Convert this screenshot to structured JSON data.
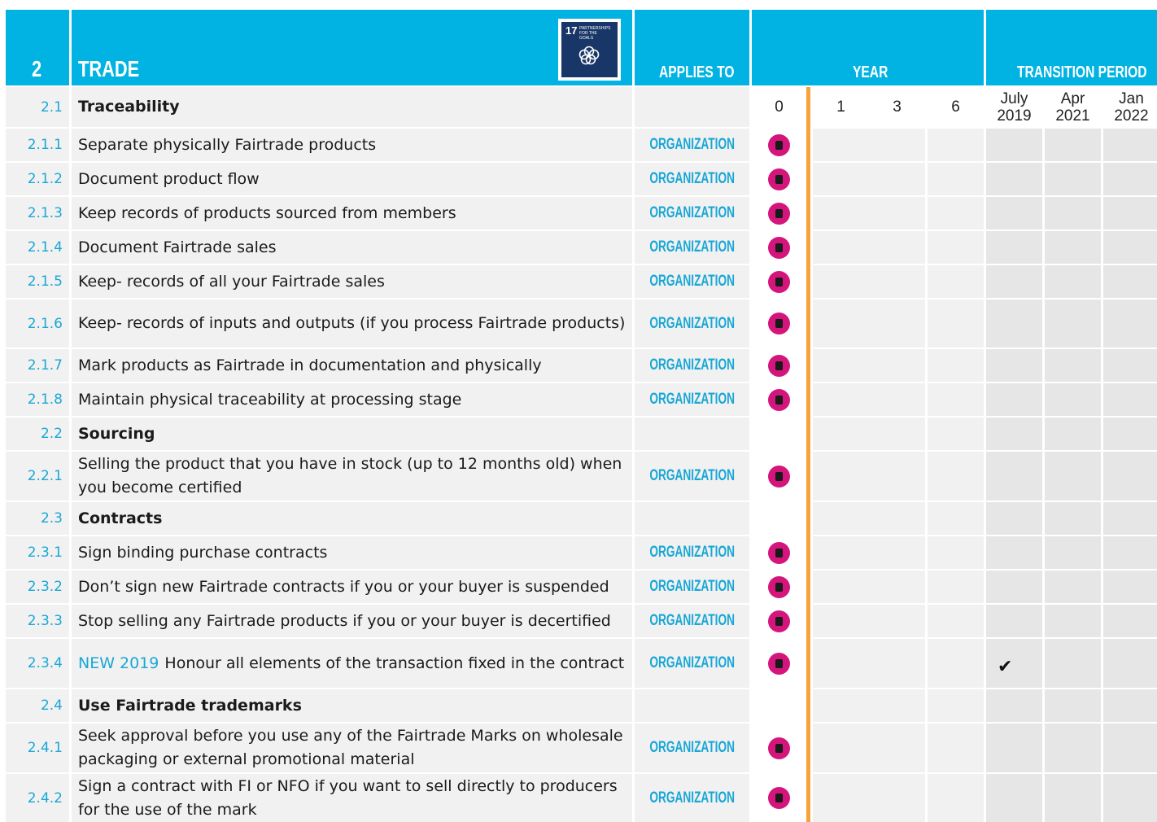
{
  "header": {
    "section_number": "2",
    "section_title": "TRADE",
    "applies_to_label": "APPLIES TO",
    "year_label": "YEAR",
    "transition_label": "TRANSITION PERIOD",
    "sdg_badge": {
      "number": "17",
      "caption": "PARTNERSHIPS FOR THE GOALS",
      "icon": "sdg-flower-icon",
      "color": "#183667"
    }
  },
  "year_columns": [
    "0",
    "1",
    "3",
    "6"
  ],
  "transition_columns": [
    {
      "month": "July",
      "year": "2019"
    },
    {
      "month": "Apr",
      "year": "2021"
    },
    {
      "month": "Jan",
      "year": "2022"
    }
  ],
  "colors": {
    "header_blue": "#00b3e3",
    "number_blue": "#1aa7d6",
    "marker_pink": "#d4157c",
    "year_divider_orange": "#f5a33a"
  },
  "rows": [
    {
      "number": "2.1",
      "text": "Traceability",
      "is_section": true
    },
    {
      "number": "2.1.1",
      "text": "Separate physically Fairtrade products",
      "applies_to": "ORGANIZATION",
      "year0_marker": "core-requirement-icon"
    },
    {
      "number": "2.1.2",
      "text": "Document product flow",
      "applies_to": "ORGANIZATION",
      "year0_marker": "core-requirement-icon"
    },
    {
      "number": "2.1.3",
      "text": "Keep records of products sourced from members",
      "applies_to": "ORGANIZATION",
      "year0_marker": "core-requirement-icon"
    },
    {
      "number": "2.1.4",
      "text": "Document Fairtrade sales",
      "applies_to": "ORGANIZATION",
      "year0_marker": "core-requirement-icon"
    },
    {
      "number": "2.1.5",
      "text": "Keep- records of all your Fairtrade sales",
      "applies_to": "ORGANIZATION",
      "year0_marker": "core-requirement-icon"
    },
    {
      "number": "2.1.6",
      "text": "Keep- records of inputs and outputs (if you process Fairtrade products)",
      "applies_to": "ORGANIZATION",
      "year0_marker": "core-requirement-icon"
    },
    {
      "number": "2.1.7",
      "text": "Mark products as Fairtrade in documentation and physically",
      "applies_to": "ORGANIZATION",
      "year0_marker": "core-requirement-icon"
    },
    {
      "number": "2.1.8",
      "text": "Maintain physical traceability at processing stage",
      "applies_to": "ORGANIZATION",
      "year0_marker": "core-requirement-icon"
    },
    {
      "number": "2.2",
      "text": "Sourcing",
      "is_section": true
    },
    {
      "number": "2.2.1",
      "text": "Selling the product that you have in stock (up to 12 months old) when you become certified",
      "applies_to": "ORGANIZATION",
      "year0_marker": "core-requirement-icon"
    },
    {
      "number": "2.3",
      "text": "Contracts",
      "is_section": true
    },
    {
      "number": "2.3.1",
      "text": "Sign binding purchase contracts",
      "applies_to": "ORGANIZATION",
      "year0_marker": "core-requirement-icon"
    },
    {
      "number": "2.3.2",
      "text": "Don’t sign new Fairtrade contracts if you or your buyer is suspended",
      "applies_to": "ORGANIZATION",
      "year0_marker": "core-requirement-icon"
    },
    {
      "number": "2.3.3",
      "text": "Stop selling any Fairtrade products if you or your buyer is decertified",
      "applies_to": "ORGANIZATION",
      "year0_marker": "core-requirement-icon"
    },
    {
      "number": "2.3.4",
      "new_tag": "NEW 2019",
      "text": "Honour all elements of the transaction fixed in the contract",
      "applies_to": "ORGANIZATION",
      "year0_marker": "core-requirement-icon",
      "transition_check": "✔"
    },
    {
      "number": "2.4",
      "text": "Use Fairtrade trademarks",
      "is_section": true
    },
    {
      "number": "2.4.1",
      "text": "Seek approval before you use any of the Fairtrade Marks on wholesale packaging or external promotional material",
      "applies_to": "ORGANIZATION",
      "year0_marker": "core-requirement-icon"
    },
    {
      "number": "2.4.2",
      "text": "Sign a contract with FI or NFO if you want to sell directly to producers for the use of the mark",
      "applies_to": "ORGANIZATION",
      "year0_marker": "core-requirement-icon"
    }
  ]
}
